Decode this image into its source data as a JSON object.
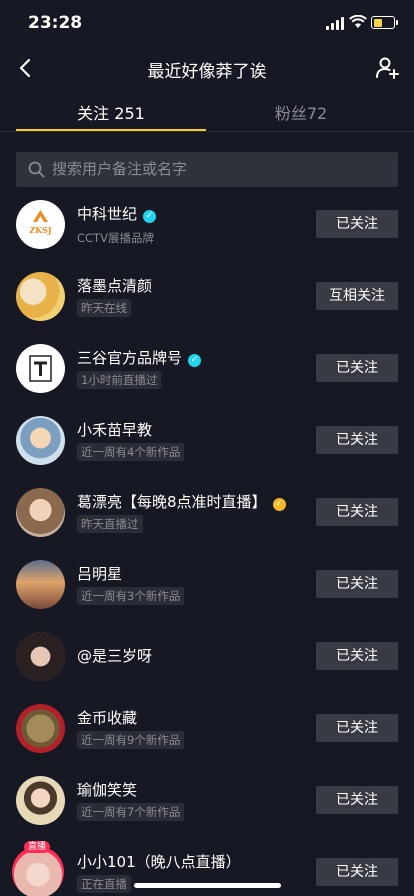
{
  "status_bar": {
    "time": "23:28"
  },
  "nav": {
    "title": "最近好像莽了诶"
  },
  "tabs": [
    {
      "label": "关注 251"
    },
    {
      "label": "粉丝72"
    }
  ],
  "search": {
    "placeholder": "搜索用户备注或名字"
  },
  "users": [
    {
      "name": "中科世纪",
      "sub": "CCTV展播品牌",
      "sub_style": "plain",
      "verified": "blue",
      "button": "已关注",
      "avatar_color": "#ffffff"
    },
    {
      "name": "落墨点清颜",
      "sub": "昨天在线",
      "sub_style": "tag",
      "verified": "",
      "button": "互相关注",
      "avatar_color": "#e8c27a"
    },
    {
      "name": "三谷官方品牌号",
      "sub": "1小时前直播过",
      "sub_style": "tag",
      "verified": "blue",
      "button": "已关注",
      "avatar_color": "#ffffff"
    },
    {
      "name": "小禾苗早教",
      "sub": "近一周有4个新作品",
      "sub_style": "tag",
      "verified": "",
      "button": "已关注",
      "avatar_color": "#9bbfd8"
    },
    {
      "name": "葛漂亮【每晚8点准时直播】",
      "sub": "昨天直播过",
      "sub_style": "tag",
      "verified": "gold",
      "button": "已关注",
      "avatar_color": "#a58a6e"
    },
    {
      "name": "吕明星",
      "sub": "近一周有3个新作品",
      "sub_style": "tag",
      "verified": "",
      "button": "已关注",
      "avatar_color": "#c58b5e"
    },
    {
      "name": "@是三岁呀",
      "sub": "",
      "sub_style": "tag",
      "verified": "",
      "button": "已关注",
      "avatar_color": "#4a3a3a"
    },
    {
      "name": "金币收藏",
      "sub": "近一周有9个新作品",
      "sub_style": "tag",
      "verified": "",
      "button": "已关注",
      "avatar_color": "#b3202a"
    },
    {
      "name": "瑜伽笑笑",
      "sub": "近一周有7个新作品",
      "sub_style": "tag",
      "verified": "",
      "button": "已关注",
      "avatar_color": "#e7d8b8"
    },
    {
      "name": "小小101（晚八点直播）",
      "sub": "正在直播",
      "sub_style": "tag",
      "verified": "",
      "button": "已关注",
      "avatar_color": "#e9b9b0",
      "live_badge": "直播"
    }
  ],
  "avatar_texts": {
    "zksj": "ZKSJ"
  }
}
